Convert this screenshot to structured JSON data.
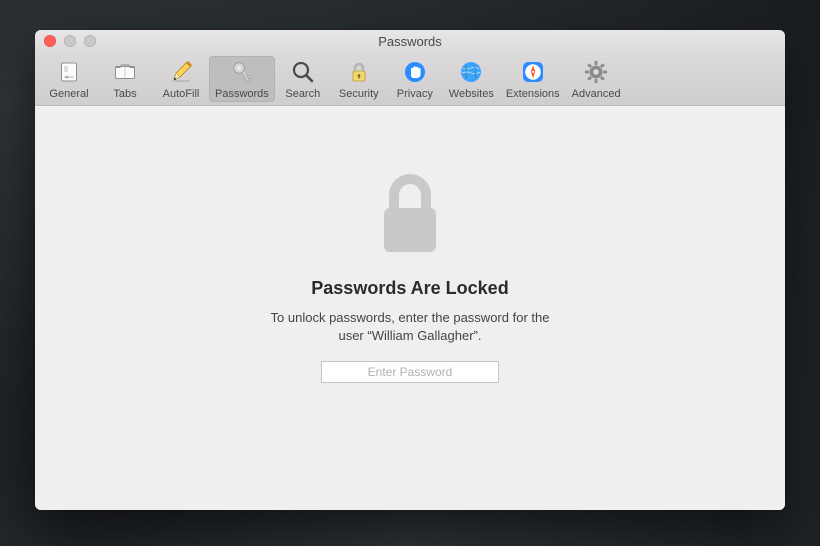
{
  "window": {
    "title": "Passwords"
  },
  "toolbar": {
    "general": {
      "label": "General"
    },
    "tabs": {
      "label": "Tabs"
    },
    "autofill": {
      "label": "AutoFill"
    },
    "passwords": {
      "label": "Passwords"
    },
    "search": {
      "label": "Search"
    },
    "security": {
      "label": "Security"
    },
    "privacy": {
      "label": "Privacy"
    },
    "websites": {
      "label": "Websites"
    },
    "extensions": {
      "label": "Extensions"
    },
    "advanced": {
      "label": "Advanced"
    }
  },
  "main": {
    "headline": "Passwords Are Locked",
    "subtext_line1": "To unlock passwords, enter the password for the",
    "subtext_line2": "user “William Gallagher”.",
    "placeholder": "Enter Password"
  },
  "colors": {
    "accent_blue": "#2b8bff",
    "accent_orange": "#ff7a1a",
    "globe_blue": "#3ea2ff",
    "gear_gray": "#8a8a8a",
    "lock_gray": "#c9c9c9"
  }
}
